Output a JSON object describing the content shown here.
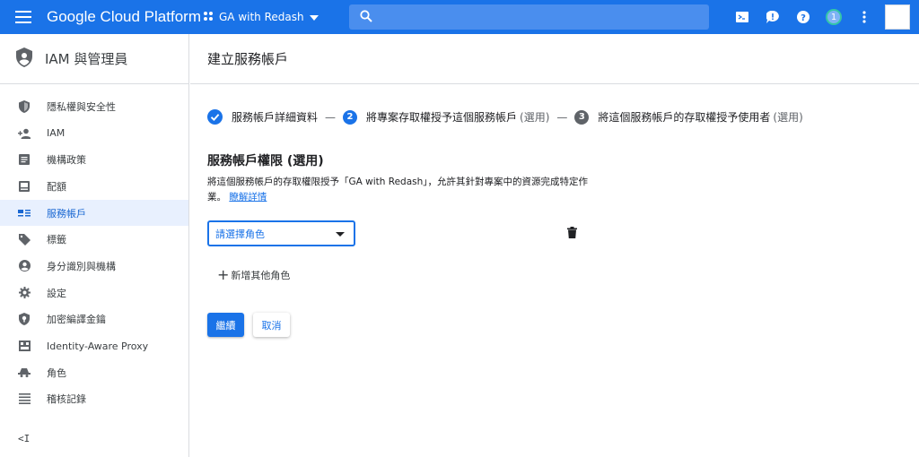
{
  "topbar": {
    "product": "Google Cloud Platform",
    "project": "GA with Redash",
    "notification_count": "1"
  },
  "sidebar": {
    "title": "IAM 與管理員",
    "items": [
      {
        "label": "隱私權與安全性",
        "icon": "shield-icon"
      },
      {
        "label": "IAM",
        "icon": "person-add-icon"
      },
      {
        "label": "機構政策",
        "icon": "document-list-icon"
      },
      {
        "label": "配額",
        "icon": "quota-icon"
      },
      {
        "label": "服務帳戶",
        "icon": "service-account-icon"
      },
      {
        "label": "標籤",
        "icon": "label-icon"
      },
      {
        "label": "身分識別與機構",
        "icon": "account-circle-icon"
      },
      {
        "label": "設定",
        "icon": "settings-icon"
      },
      {
        "label": "加密編譯金鑰",
        "icon": "security-key-icon"
      },
      {
        "label": "Identity-Aware Proxy",
        "icon": "proxy-icon"
      },
      {
        "label": "角色",
        "icon": "roles-icon"
      },
      {
        "label": "稽核記錄",
        "icon": "audit-list-icon"
      }
    ],
    "active_index": 4,
    "collapse_label": "<I"
  },
  "page": {
    "title": "建立服務帳戶"
  },
  "stepper": {
    "step1": "服務帳戶詳細資料",
    "step2_num": "2",
    "step2": "將專案存取權授予這個服務帳戶",
    "step2_opt": "(選用)",
    "step3_num": "3",
    "step3": "將這個服務帳戶的存取權授予使用者",
    "step3_opt": "(選用)",
    "separator": "—"
  },
  "section": {
    "title": "服務帳戶權限 (選用)",
    "desc": "將這個服務帳戶的存取權限授予「GA with Redash」，允許其針對專案中的資源完成特定作業。",
    "learn_more": "瞭解詳情"
  },
  "role_select": {
    "placeholder": "請選擇角色"
  },
  "add_role": "新增其他角色",
  "buttons": {
    "continue": "繼續",
    "cancel": "取消"
  },
  "colors": {
    "brand": "#1a73e8",
    "active_bg": "#e8f0fe"
  }
}
